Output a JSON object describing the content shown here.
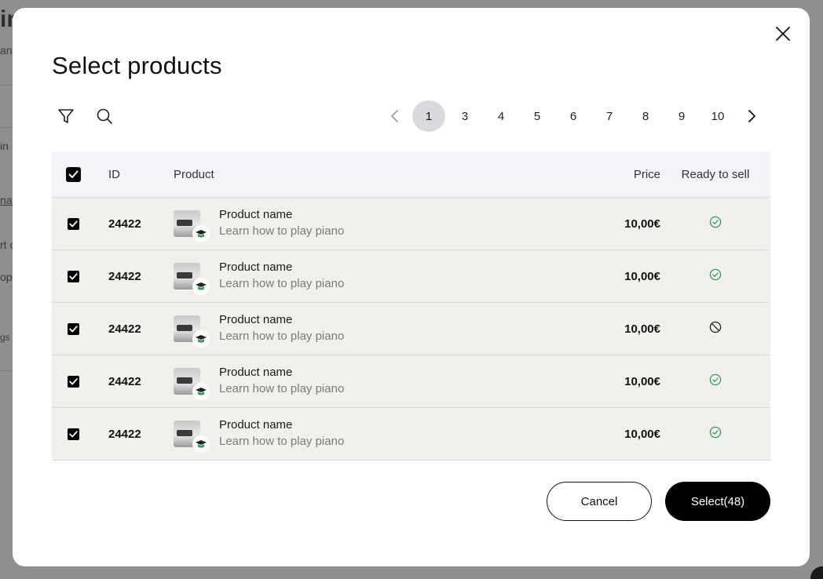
{
  "background": {
    "fragments": [
      "in",
      "an",
      "in",
      "nar",
      "rt c",
      "opc",
      "gs"
    ]
  },
  "modal": {
    "title": "Select products",
    "close_icon": "close-icon"
  },
  "toolbar": {
    "filter_icon": "filter-icon",
    "search_icon": "search-icon"
  },
  "pagination": {
    "pages": [
      "1",
      "3",
      "4",
      "5",
      "6",
      "7",
      "8",
      "9",
      "10"
    ],
    "current": "1"
  },
  "table": {
    "headers": {
      "id": "ID",
      "product": "Product",
      "price": "Price",
      "ready": "Ready to sell"
    },
    "rows": [
      {
        "id": "24422",
        "name": "Product name",
        "desc": "Learn how to play piano",
        "price": "10,00€",
        "ready": "ready-check-icon",
        "checked": true
      },
      {
        "id": "24422",
        "name": "Product name",
        "desc": "Learn how to play piano",
        "price": "10,00€",
        "ready": "ready-check-icon",
        "checked": true
      },
      {
        "id": "24422",
        "name": "Product name",
        "desc": "Learn how to play piano",
        "price": "10,00€",
        "ready": "not-ready-icon",
        "checked": true
      },
      {
        "id": "24422",
        "name": "Product name",
        "desc": "Learn how to play piano",
        "price": "10,00€",
        "ready": "ready-check-icon",
        "checked": true
      },
      {
        "id": "24422",
        "name": "Product name",
        "desc": "Learn how to play piano",
        "price": "10,00€",
        "ready": "ready-check-icon",
        "checked": true
      }
    ]
  },
  "footer": {
    "cancel_label": "Cancel",
    "select_label": "Select(48)"
  },
  "colors": {
    "overlay": "#8e8e8e",
    "row_bg": "#f1f0ec",
    "header_bg": "#f2f4f7",
    "active_page": "#d9dadd",
    "ready_green": "#2f9e5a",
    "primary": "#000000"
  }
}
